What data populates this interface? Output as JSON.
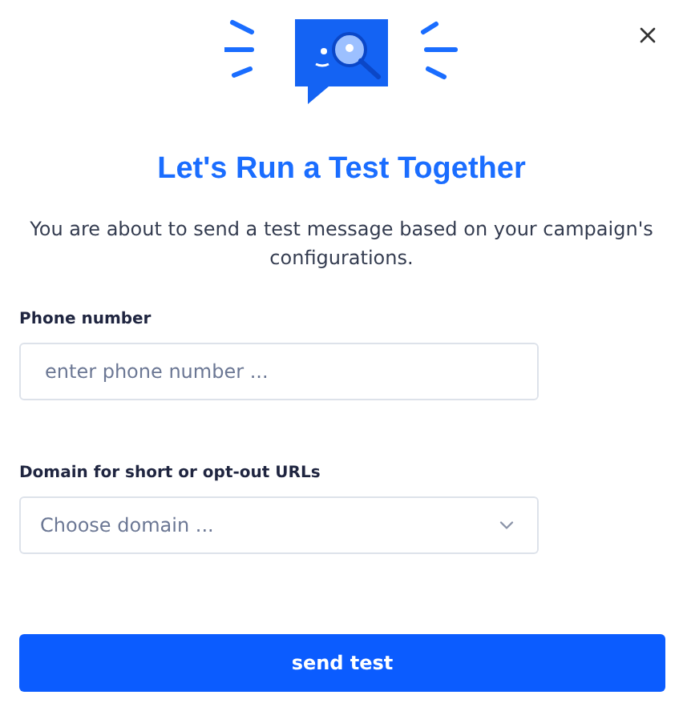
{
  "title": "Let's Run a Test Together",
  "description": "You are about to send a test message based on your campaign's configurations.",
  "fields": [
    {
      "kind": "input",
      "label": "Phone number",
      "placeholder": "enter phone number ..."
    },
    {
      "kind": "select",
      "label": "Domain for short or opt-out URLs",
      "placeholder": "Choose domain ..."
    }
  ],
  "button": "send test"
}
